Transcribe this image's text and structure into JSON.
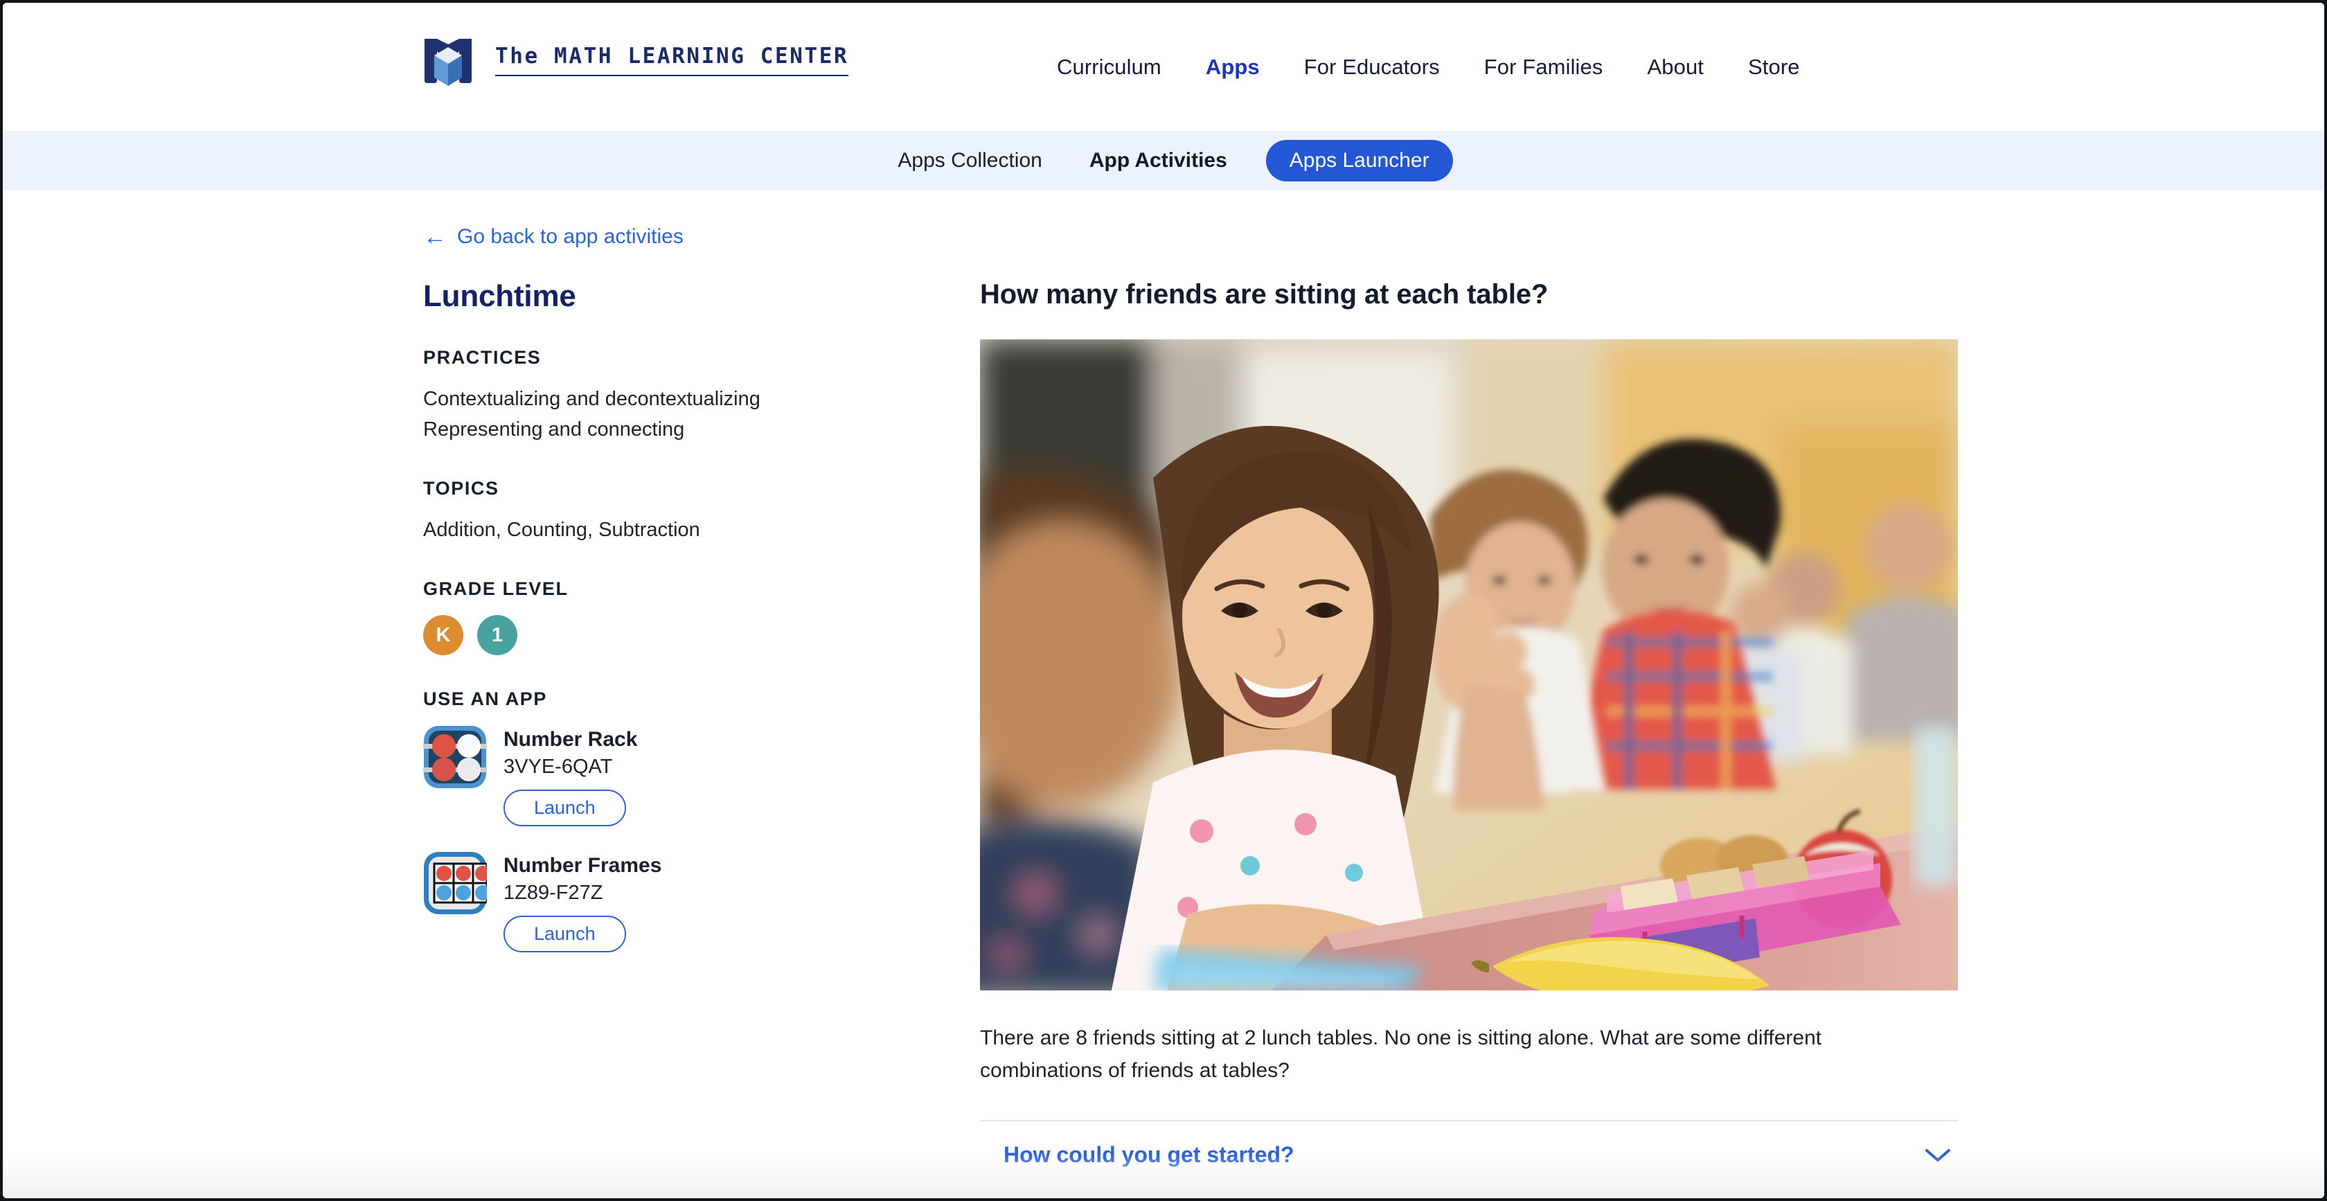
{
  "brand": {
    "name": "The MATH LEARNING CENTER",
    "logo_icon": "mlc-logo-icon"
  },
  "main_nav": {
    "items": [
      {
        "label": "Curriculum",
        "active": false
      },
      {
        "label": "Apps",
        "active": true
      },
      {
        "label": "For Educators",
        "active": false
      },
      {
        "label": "For Families",
        "active": false
      },
      {
        "label": "About",
        "active": false
      },
      {
        "label": "Store",
        "active": false
      }
    ]
  },
  "sub_nav": {
    "items": [
      {
        "label": "Apps Collection",
        "style": "plain"
      },
      {
        "label": "App Activities",
        "style": "bold"
      },
      {
        "label": "Apps Launcher",
        "style": "pill"
      }
    ]
  },
  "back_link": {
    "label": "Go back to app activities",
    "arrow": "←",
    "icon": "arrow-left-icon"
  },
  "sidebar": {
    "activity_title": "Lunchtime",
    "practices": {
      "label": "PRACTICES",
      "value": "Contextualizing and decontextualizing\nRepresenting and connecting",
      "lines": [
        "Contextualizing and decontextualizing",
        "Representing and connecting"
      ]
    },
    "topics": {
      "label": "TOPICS",
      "value": "Addition, Counting, Subtraction"
    },
    "grade_level": {
      "label": "GRADE LEVEL",
      "badges": [
        {
          "text": "K",
          "color": "#DD8B31"
        },
        {
          "text": "1",
          "color": "#48A3A0"
        }
      ]
    },
    "use_an_app": {
      "label": "USE AN APP",
      "apps": [
        {
          "name": "Number Rack",
          "code": "3VYE-6QAT",
          "launch_label": "Launch",
          "icon": "number-rack-icon"
        },
        {
          "name": "Number Frames",
          "code": "1Z89-F27Z",
          "launch_label": "Launch",
          "icon": "number-frames-icon"
        }
      ]
    }
  },
  "main": {
    "question_title": "How many friends are sitting at each table?",
    "photo_alt": "Children sitting at a school lunch table with lunchboxes, a banana and an apple",
    "problem_text": "There are 8 friends sitting at 2 lunch tables. No one is sitting alone. What are some different combinations of friends at tables?",
    "accordion": [
      {
        "title": "How could you get started?",
        "expanded": false,
        "icon": "chevron-down-icon"
      }
    ]
  },
  "colors": {
    "brand_navy": "#1b2a6b",
    "accent_blue": "#2a62e0",
    "pill_blue": "#2357d6",
    "subnav_bg": "#edf3fc",
    "text_dark": "#16202e"
  }
}
